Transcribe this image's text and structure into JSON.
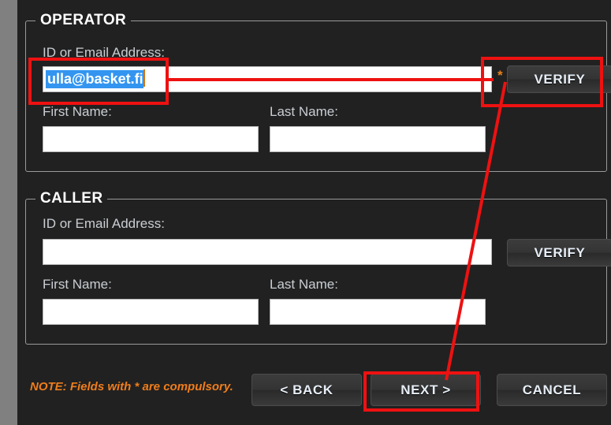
{
  "colors": {
    "background": "#212121",
    "gutter": "#808080",
    "fieldset_border": "#9a9a9a",
    "label_text": "#c9ced3",
    "legend_text": "#ffffff",
    "button_text": "#e7eef7",
    "accent_orange": "#ef7d1b",
    "selection_blue": "#3395f0",
    "annotation_red": "#ee1111"
  },
  "sections": [
    {
      "legend": "OPERATOR",
      "id_label": "ID or Email Address:",
      "id_value": "ulla@basket.fi",
      "id_value_selected": true,
      "required_marker": "*",
      "verify_label": "VERIFY",
      "first_name_label": "First Name:",
      "first_name_value": "",
      "last_name_label": "Last Name:",
      "last_name_value": ""
    },
    {
      "legend": "CALLER",
      "id_label": "ID or Email Address:",
      "id_value": "",
      "id_value_selected": false,
      "required_marker": "",
      "verify_label": "VERIFY",
      "first_name_label": "First Name:",
      "first_name_value": "",
      "last_name_label": "Last Name:",
      "last_name_value": ""
    }
  ],
  "footer": {
    "note": "NOTE: Fields with * are compulsory.",
    "back_label": "< BACK",
    "next_label": "NEXT >",
    "cancel_label": "CANCEL"
  },
  "annotations": {
    "highlight_email_input": true,
    "highlight_verify_button": true,
    "highlight_next_button": true,
    "connector_line": true
  }
}
